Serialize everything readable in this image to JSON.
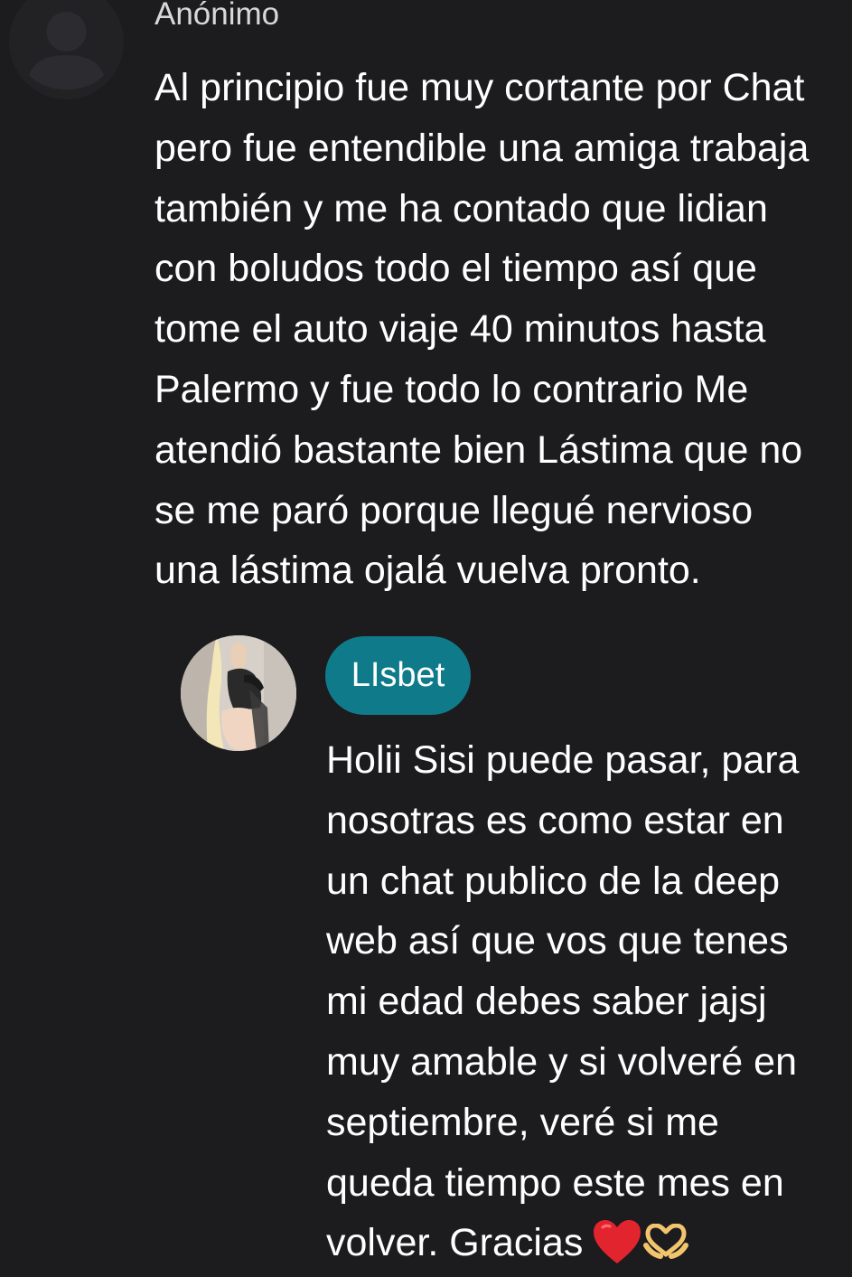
{
  "comment": {
    "author": "Anónimo",
    "text": "Al principio fue muy cortante por Chat\npero fue entendible una amiga trabaja\ntambién y me ha contado que lidian\ncon boludos todo el tiempo así que\ntome el auto viaje 40 minutos hasta\nPalermo y fue todo lo contrario Me\natendió bastante bien Lástima que no\nse me paró porque llegué nervioso\nuna lástima ojalá vuelva pronto.",
    "avatar_icon": "person-placeholder-icon"
  },
  "reply": {
    "author": "LIsbet",
    "badge_color": "#0f7b8a",
    "text": "Holii Sisi puede pasar, para\nnosotras es como estar en\nun chat publico de la deep\nweb así que vos que tenes\nmi edad debes saber jajsj\nmuy amable y si volveré en\nseptiembre, veré si me\nqueda tiempo este mes en\nvolver. Gracias",
    "emojis": [
      "red-heart-icon",
      "heart-hands-icon"
    ]
  },
  "colors": {
    "background": "#1c1c1e",
    "text": "#ffffff",
    "author_text": "#d8d8d8",
    "accent": "#0f7b8a"
  }
}
